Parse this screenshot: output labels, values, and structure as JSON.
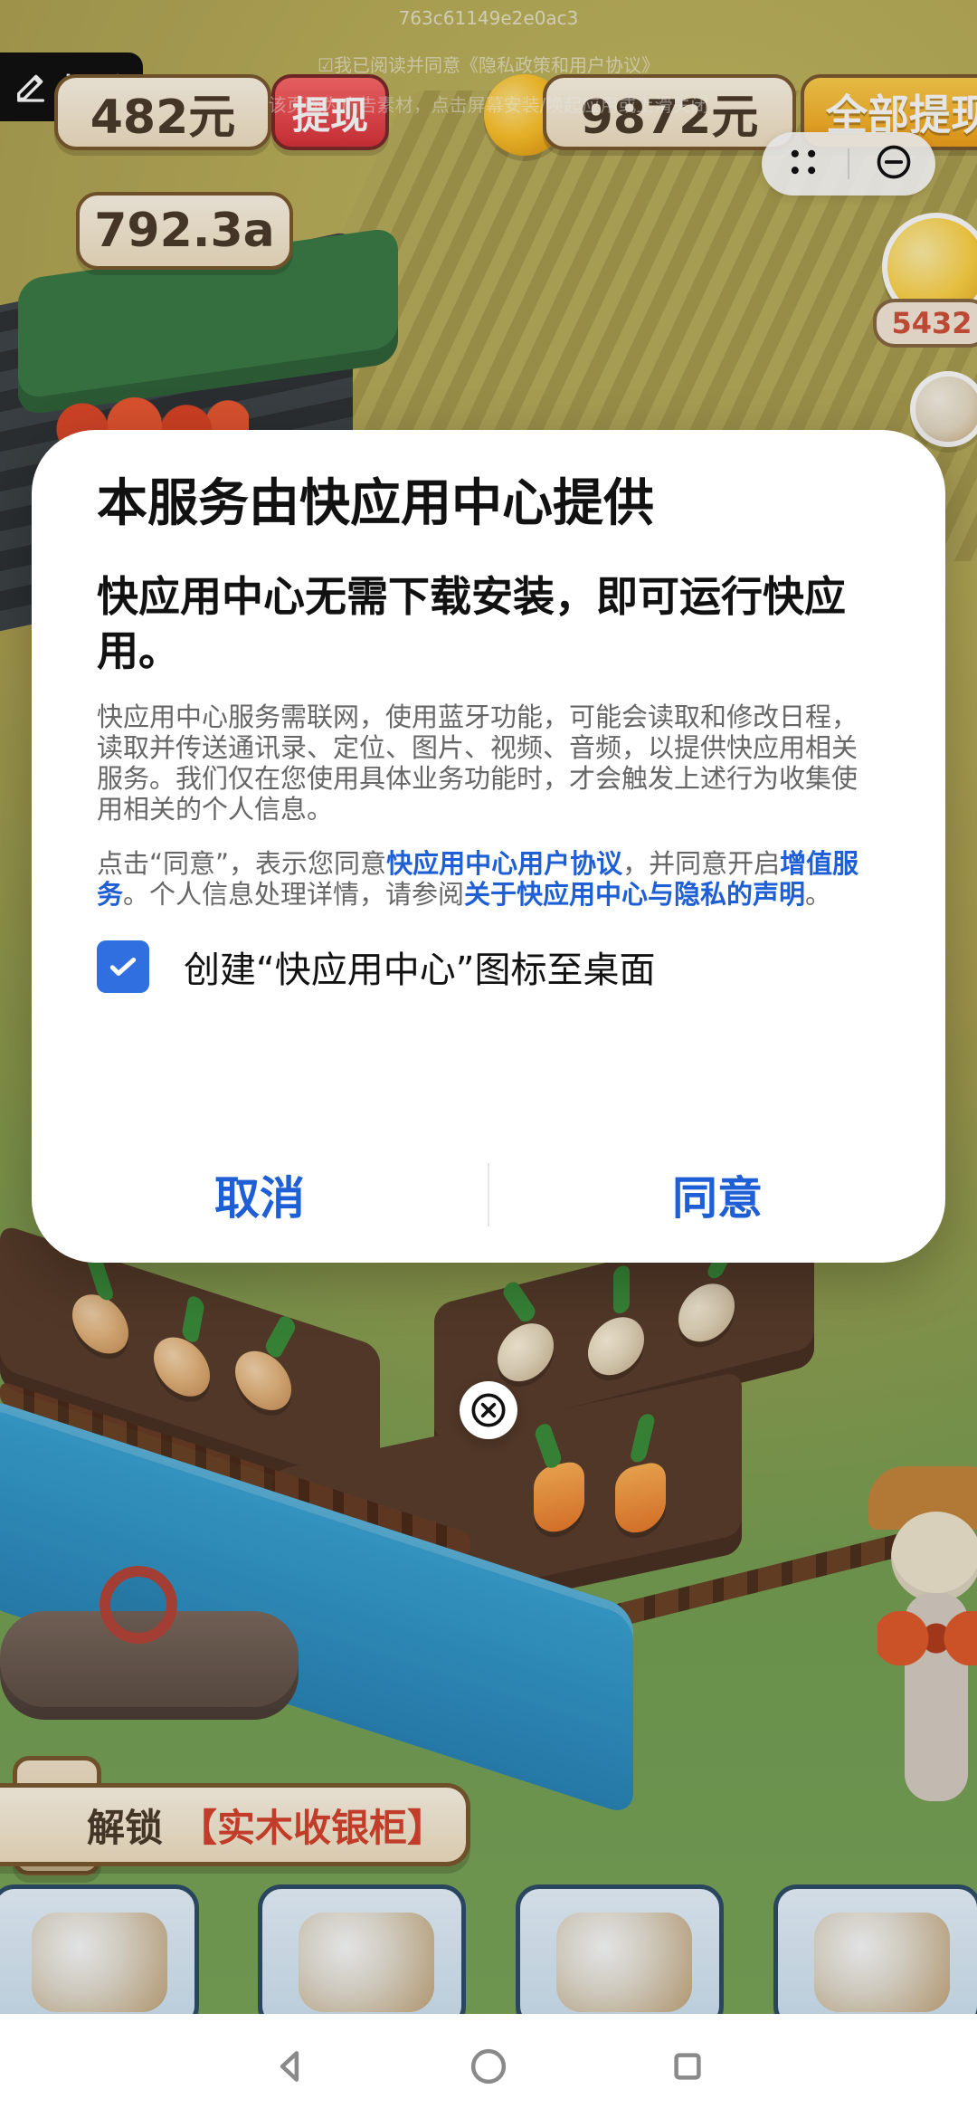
{
  "overlay": {
    "id_text": "763c61149e2e0ac3",
    "agree_text": "☑我已阅读并同意《隐私政策和用户协议》",
    "tip_text": "该页面为广告素材，点击屏幕安装/唤起应用或上滑关闭"
  },
  "hud": {
    "report_label": "投诉",
    "money_left": "482元",
    "withdraw_label": "提现",
    "money_right": "9872元",
    "all_withdraw_label": "全部提现",
    "score": "792.3a",
    "smile_count": "5432"
  },
  "dialog": {
    "title": "本服务由快应用中心提供",
    "subtitle": "快应用中心无需下载安装，即可运行快应用。",
    "paragraph1": "快应用中心服务需联网，使用蓝牙功能，可能会读取和修改日程，读取并传送通讯录、定位、图片、视频、音频，以提供快应用相关服务。我们仅在您使用具体业务功能时，才会触发上述行为收集使用相关的个人信息。",
    "paragraph2_prefix": "点击“同意”，表示您同意",
    "link_user_agreement": "快应用中心用户协议",
    "paragraph2_mid": "，并同意开启",
    "link_value_service": "增值服务",
    "paragraph2_mid2": "。个人信息处理详情，请参阅",
    "link_privacy_statement": "关于快应用中心与隐私的声明",
    "paragraph2_suffix": "。",
    "checkbox_label": "创建“快应用中心”图标至桌面",
    "cancel_label": "取消",
    "agree_label": "同意"
  },
  "bottom": {
    "unlock_prefix": "解锁",
    "unlock_item": "【实木收银柜】"
  },
  "icons": {
    "report": "edit-icon",
    "capsule_menu": "dots-grid-icon",
    "capsule_minimize": "minus-circle-icon",
    "close": "close-icon",
    "nav_back": "triangle-back-icon",
    "nav_home": "circle-home-icon",
    "nav_recent": "square-recent-icon"
  },
  "colors": {
    "link_blue": "#1f5fd6",
    "checkbox_blue": "#2f6fe0"
  }
}
